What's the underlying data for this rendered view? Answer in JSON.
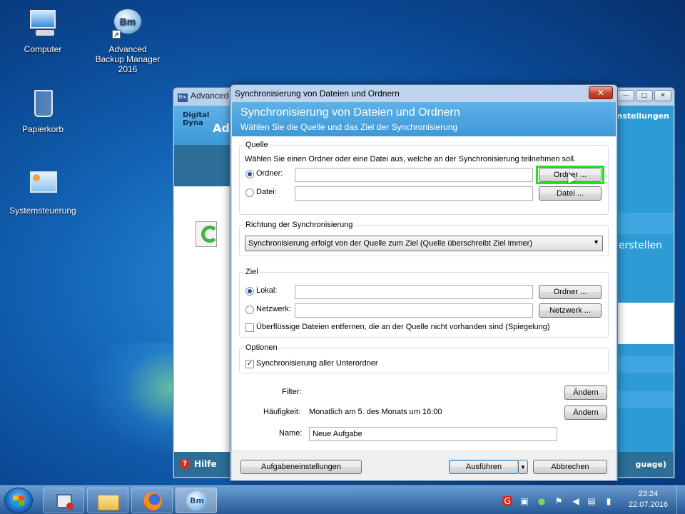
{
  "desktop": {
    "icons": [
      {
        "label": "Computer"
      },
      {
        "label": "Advanced Backup Manager 2016"
      },
      {
        "label": "Papierkorb"
      },
      {
        "label": "Systemsteuerung"
      }
    ]
  },
  "bg_window": {
    "title": "Advanced",
    "left_title": "Digital Dyna",
    "left_sub": "Ad",
    "help_label": "Hilfe",
    "right_items": [
      "Einstellungen",
      "erstellen",
      "guage)"
    ]
  },
  "dialog": {
    "title": "Synchronisierung von Dateien und Ordnern",
    "header_title": "Synchronisierung von Dateien und Ordnern",
    "header_subtitle": "Wählen Sie die Quelle und das Ziel der Synchronisierung",
    "source": {
      "legend": "Quelle",
      "hint": "Wählen Sie einen Ordner oder eine Datei aus, welche an der Synchronisierung teilnehmen soll.",
      "folder_label": "Ordner:",
      "folder_value": "",
      "folder_button": "Ordner ...",
      "file_label": "Datei:",
      "file_value": "",
      "file_button": "Datei ..."
    },
    "direction": {
      "legend": "Richtung der Synchronisierung",
      "selected": "Synchronisierung erfolgt von der Quelle zum Ziel (Quelle überschreibt Ziel immer)"
    },
    "target": {
      "legend": "Ziel",
      "local_label": "Lokal:",
      "local_value": "",
      "local_button": "Ordner ...",
      "network_label": "Netzwerk:",
      "network_value": "",
      "network_button": "Netzwerk ...",
      "mirror_label": "Überflüssige Dateien entfernen, die an der Quelle nicht vorhanden sind (Spiegelung)"
    },
    "options": {
      "legend": "Optionen",
      "subfolders_label": "Synchronisierung aller Unterordner"
    },
    "filter_label": "Filter:",
    "filter_button": "Ändern",
    "frequency_label": "Häufigkeit:",
    "frequency_value": "Monatlich am 5. des Monats um 16:00",
    "frequency_button": "Ändern",
    "name_label": "Name:",
    "name_value": "Neue Aufgabe",
    "footer": {
      "settings_button": "Aufgabeneinstellungen",
      "run_button": "Ausführen",
      "cancel_button": "Abbrechen"
    }
  },
  "taskbar": {
    "time": "23:24",
    "date": "22.07.2016"
  },
  "colors": {
    "highlight": "#22e01c",
    "header_blue": "#3d99d8"
  }
}
